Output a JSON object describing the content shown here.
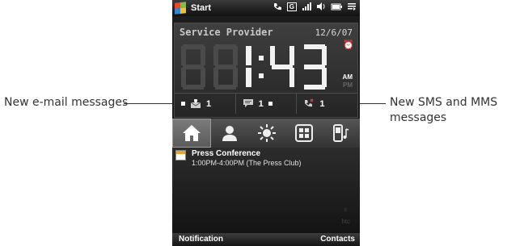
{
  "annotations": {
    "left_callout": "New e-mail messages",
    "right_callout_line1": "New SMS and MMS",
    "right_callout_line2": "messages"
  },
  "status_bar": {
    "start_label": "Start",
    "icons": [
      "phone-icon",
      "gprs-icon",
      "signal-icon",
      "volume-icon",
      "battery-icon",
      "connectivity-icon"
    ],
    "gprs_label": "G"
  },
  "home": {
    "provider": "Service Provider",
    "date": "12/6/07",
    "time": "1:43",
    "am_label": "AM",
    "pm_label": "PM"
  },
  "notifications": {
    "email_count": "1",
    "sms_count": "1",
    "missed_calls_count": "1"
  },
  "tabs": [
    {
      "name": "home",
      "icon": "house-icon",
      "active": true
    },
    {
      "name": "people",
      "icon": "person-icon",
      "active": false
    },
    {
      "name": "weather",
      "icon": "sun-icon",
      "active": false
    },
    {
      "name": "launcher",
      "icon": "grid-icon",
      "active": false
    },
    {
      "name": "music",
      "icon": "phone-music-icon",
      "active": false
    }
  ],
  "appointment": {
    "title": "Press Conference",
    "time": "1:00PM-4:00PM (The Press Club)"
  },
  "brand": {
    "logo": "htc"
  },
  "softkeys": {
    "left": "Notification",
    "right": "Contacts"
  },
  "colors": {
    "screen_bg": "#1c1c1c",
    "active_tab": "#6b6b6b",
    "calendar_accent": "#e8a43a"
  }
}
